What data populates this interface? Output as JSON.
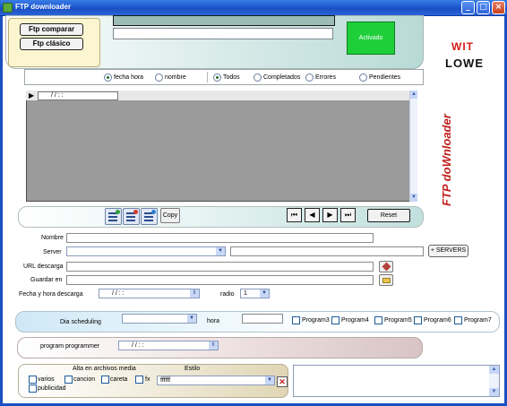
{
  "window": {
    "title": "FTP downloader",
    "minimize": "_",
    "maximize": "□",
    "close": "×"
  },
  "mode": {
    "compare_label": "Ftp comparar",
    "classic_label": "Ftp clásico"
  },
  "status": {
    "activado_label": "Activado"
  },
  "logos": {
    "wit": "WIT",
    "lowe": "LOWE",
    "vertical": "FTP doWnloader"
  },
  "filters": {
    "sort": [
      {
        "label": "fecha hora",
        "selected": true
      },
      {
        "label": "nombre",
        "selected": false
      }
    ],
    "state": [
      {
        "label": "Todos",
        "selected": true
      },
      {
        "label": "Completados",
        "selected": false
      },
      {
        "label": "Errores",
        "selected": false
      },
      {
        "label": "Pendientes",
        "selected": false
      }
    ]
  },
  "grid": {
    "date_mask": "/  /      :  :"
  },
  "toolbar": {
    "copy_label": "Copy",
    "first": "⏮",
    "prev": "◀",
    "next": "▶",
    "last": "⏭",
    "reset_label": "Reset"
  },
  "form": {
    "nombre_label": "Nombre",
    "server_label": "Server",
    "url_label": "URL descarga",
    "guardar_label": "Guardar en",
    "fecha_label": "Fecha y hora descarga",
    "fecha_mask": "/  /      :  :",
    "radio_label": "radio",
    "radio_value": "1",
    "servers_button": "+ SERVERS"
  },
  "scheduling": {
    "dia_label": "Dia scheduling",
    "hora_label": "hora",
    "programs": [
      "Program3",
      "Program4",
      "Program5",
      "Program6",
      "Program7"
    ]
  },
  "programmer": {
    "label": "program programmer",
    "mask": "/  /      :  :"
  },
  "media": {
    "alta_label": "Alta en archivos media",
    "estilo_label": "Estilo",
    "estilo_value": "ffffff",
    "checks": [
      "varios",
      "cancion",
      "careta",
      "fx",
      "publicidad"
    ]
  },
  "colors": {
    "accent": "#1ecf3a",
    "title_bar": "#1f5ad1",
    "logo_red": "#d4201a"
  }
}
